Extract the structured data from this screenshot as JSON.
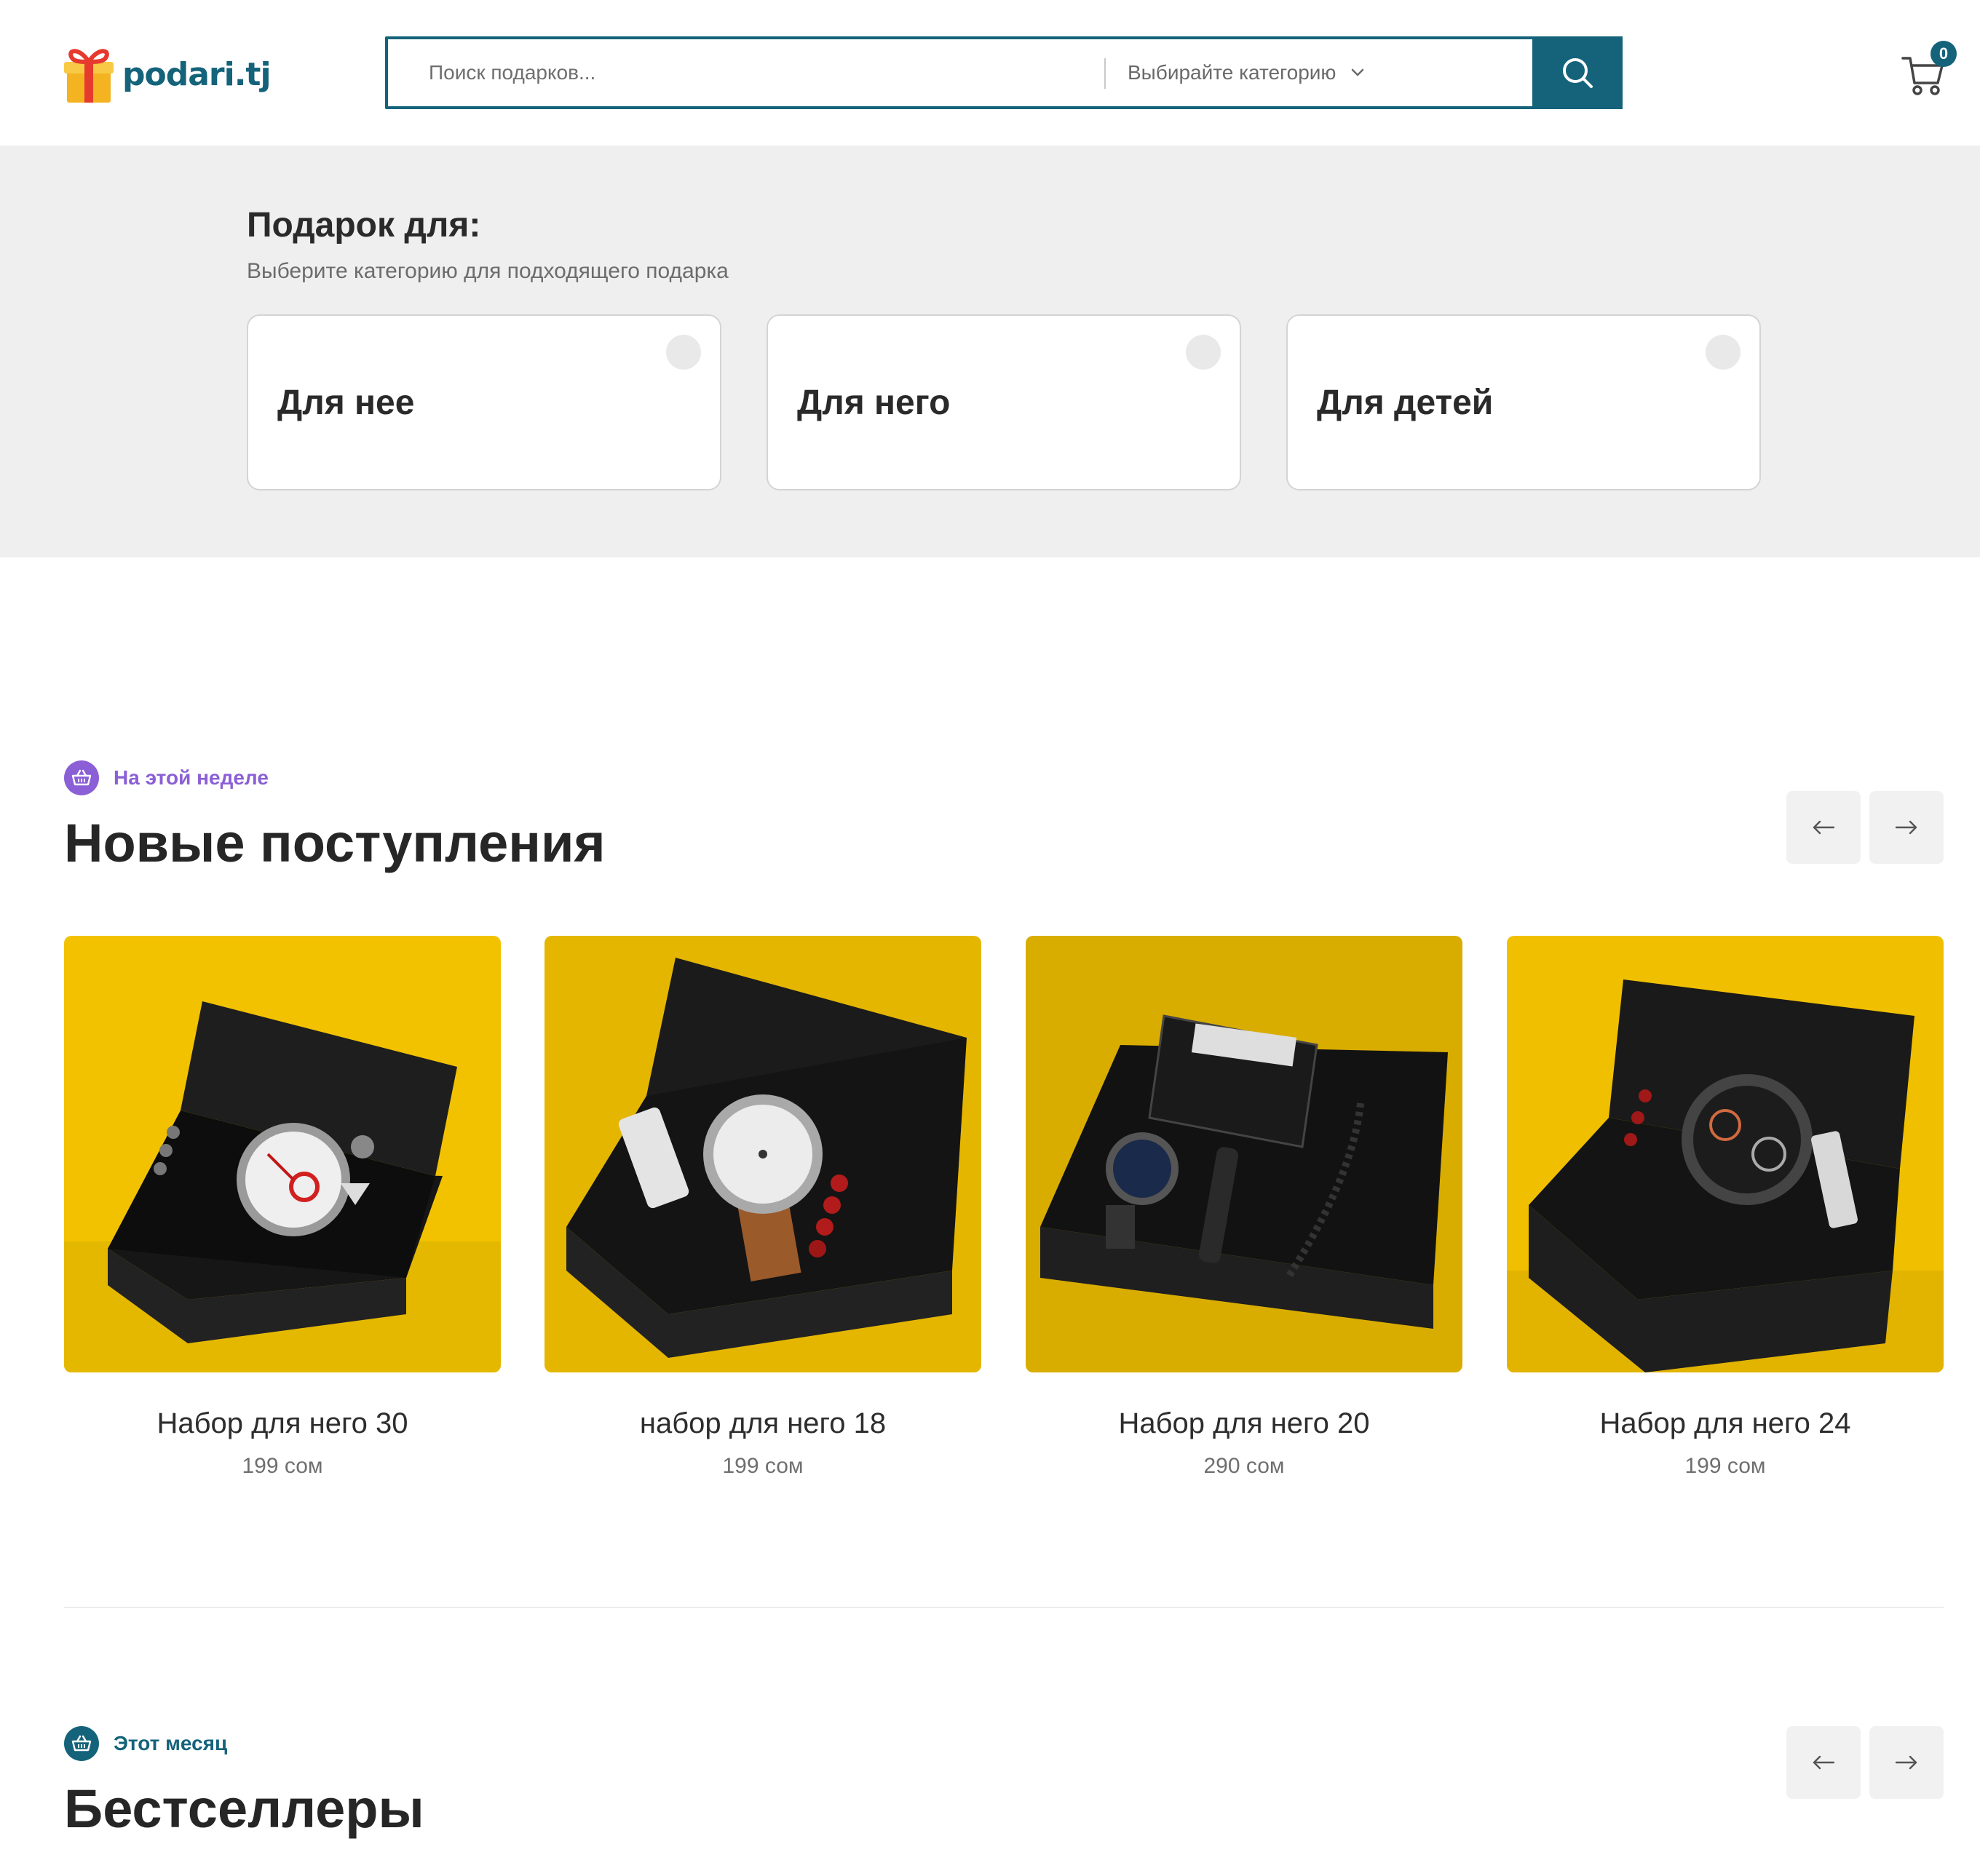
{
  "header": {
    "logo_text": "podari.tj",
    "search": {
      "placeholder": "Поиск подарков..."
    },
    "category_select": {
      "label": "Выбирайте категорию"
    },
    "cart": {
      "count": "0"
    }
  },
  "gift_for": {
    "title": "Подарок для:",
    "subtitle": "Выберите категорию для подходящего подарка",
    "cards": [
      {
        "label": "Для нее"
      },
      {
        "label": "Для него"
      },
      {
        "label": "Для детей"
      }
    ]
  },
  "new_arrivals": {
    "tag": "На этой неделе",
    "title": "Новые поступления",
    "tag_color": "#8b5fd6",
    "products": [
      {
        "name": "Набор для него 30",
        "price": "199 сом"
      },
      {
        "name": "набор для него 18",
        "price": "199 сом"
      },
      {
        "name": "Набор для него 20",
        "price": "290 сом"
      },
      {
        "name": "Набор для него 24",
        "price": "199 сом"
      }
    ]
  },
  "bestsellers": {
    "tag": "Этот месяц",
    "title": "Бестселлеры",
    "tag_color": "#14637a"
  },
  "icons": {
    "search": "search-icon",
    "cart": "cart-icon",
    "chevron": "chevron-down-icon",
    "prev": "arrow-left-icon",
    "next": "arrow-right-icon",
    "basket": "basket-icon"
  },
  "colors": {
    "brand": "#14637a",
    "band_bg": "#efefef",
    "product_bg": "#f2c200"
  }
}
